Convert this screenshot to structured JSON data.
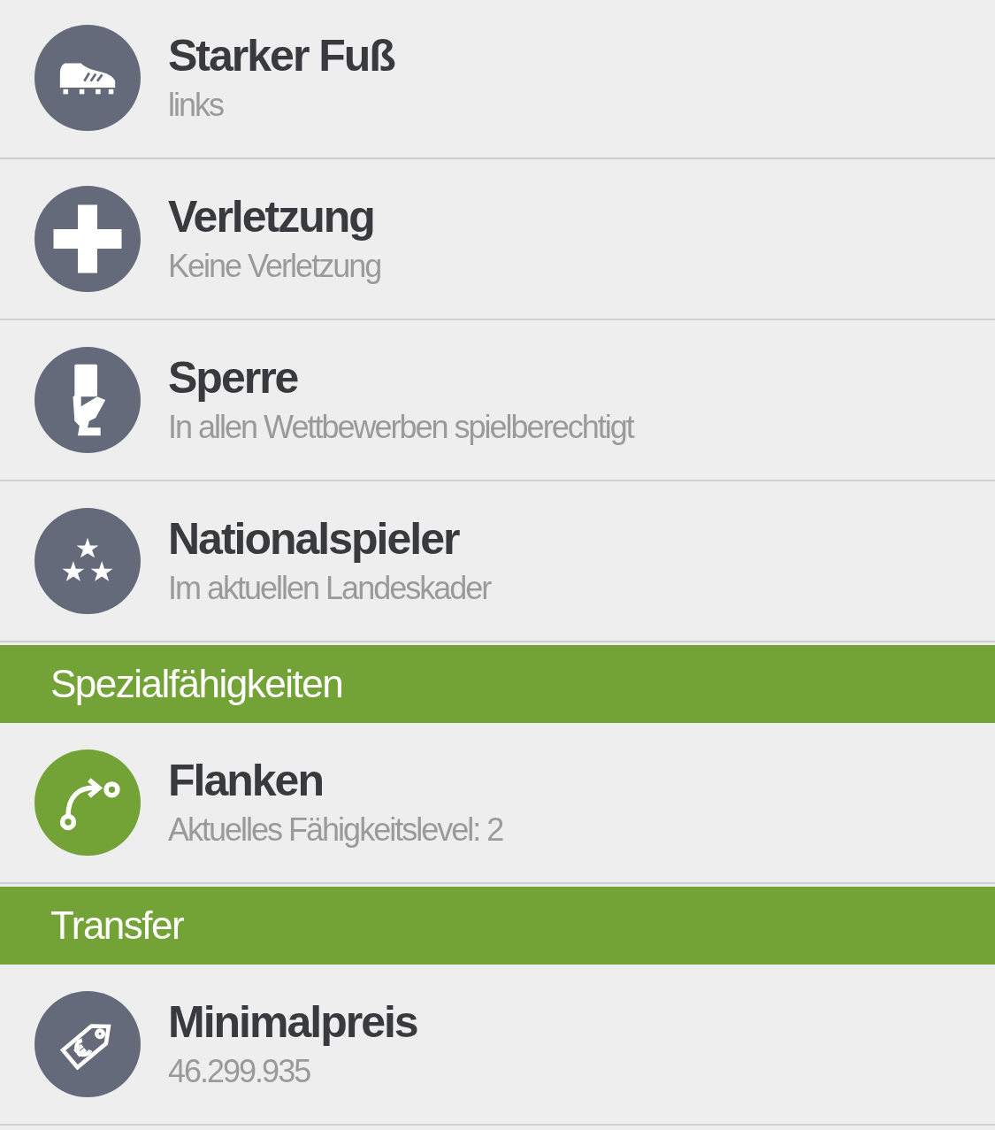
{
  "items": [
    {
      "kind": "row",
      "color": "#646a7a",
      "title": "Starker Fuß",
      "subtitle": "links"
    },
    {
      "kind": "row",
      "color": "#646a7a",
      "title": "Verletzung",
      "subtitle": "Keine Verletzung"
    },
    {
      "kind": "row",
      "color": "#646a7a",
      "title": "Sperre",
      "subtitle": "In allen Wettbewerben spielberechtigt"
    },
    {
      "kind": "row",
      "color": "#646a7a",
      "title": "Nationalspieler",
      "subtitle": "Im aktuellen Landeskader"
    },
    {
      "kind": "header",
      "title": "Spezialfähigkeiten"
    },
    {
      "kind": "row",
      "color": "#73a336",
      "title": "Flanken",
      "subtitle": "Aktuelles Fähigkeitslevel: 2"
    },
    {
      "kind": "header",
      "title": "Transfer"
    },
    {
      "kind": "row",
      "color": "#646a7a",
      "title": "Minimalpreis",
      "subtitle": "46.299.935"
    }
  ]
}
